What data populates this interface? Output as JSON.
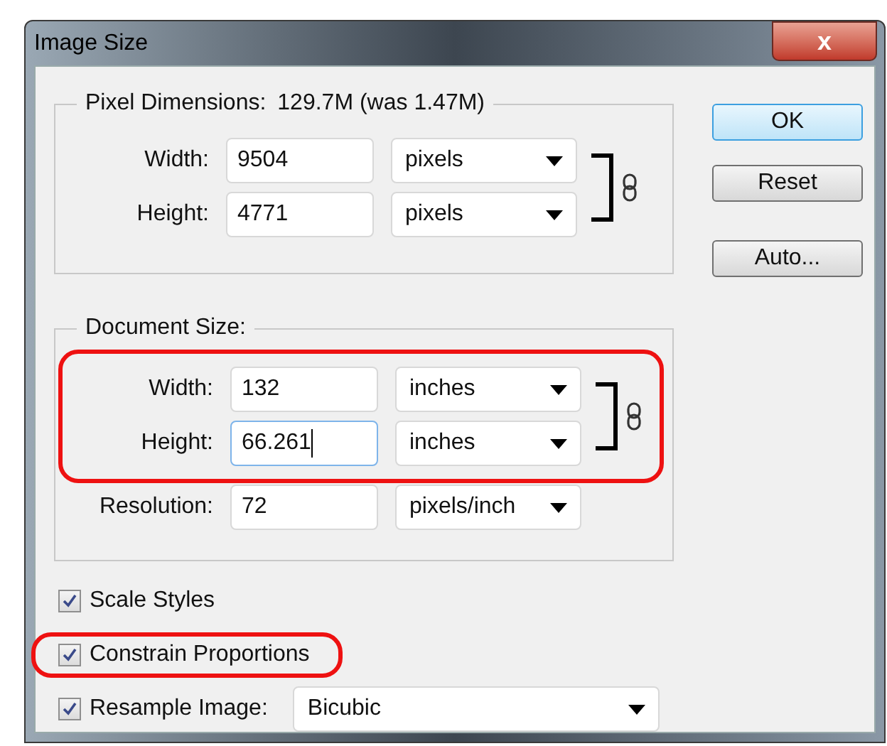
{
  "window": {
    "title": "Image Size",
    "close": "x"
  },
  "pixel_dimensions": {
    "legend": "Pixel Dimensions:",
    "summary": "129.7M (was 1.47M)",
    "linked": true,
    "rows": [
      {
        "label": "Width:",
        "value": "9504",
        "unit": "pixels",
        "focused": false
      },
      {
        "label": "Height:",
        "value": "4771",
        "unit": "pixels",
        "focused": false
      }
    ]
  },
  "document_size": {
    "legend": "Document Size:",
    "highlighted": true,
    "linked": true,
    "rows": [
      {
        "label": "Width:",
        "value": "132",
        "unit": "inches",
        "focused": false
      },
      {
        "label": "Height:",
        "value": "66.261",
        "unit": "inches",
        "focused": true
      }
    ],
    "resolution": {
      "label": "Resolution:",
      "value": "72",
      "unit": "pixels/inch",
      "focused": false
    }
  },
  "options": [
    {
      "kind": "checkbox",
      "label": "Scale Styles",
      "checked": true,
      "highlighted": false
    },
    {
      "kind": "checkbox",
      "label": "Constrain Proportions",
      "checked": true,
      "highlighted": true
    },
    {
      "kind": "select",
      "label": "Resample Image:",
      "checked": true,
      "highlighted": false,
      "value": "Bicubic"
    }
  ],
  "buttons": [
    {
      "label": "OK",
      "default": true
    },
    {
      "label": "Reset",
      "default": false
    },
    {
      "label": "Auto...",
      "default": false
    }
  ]
}
